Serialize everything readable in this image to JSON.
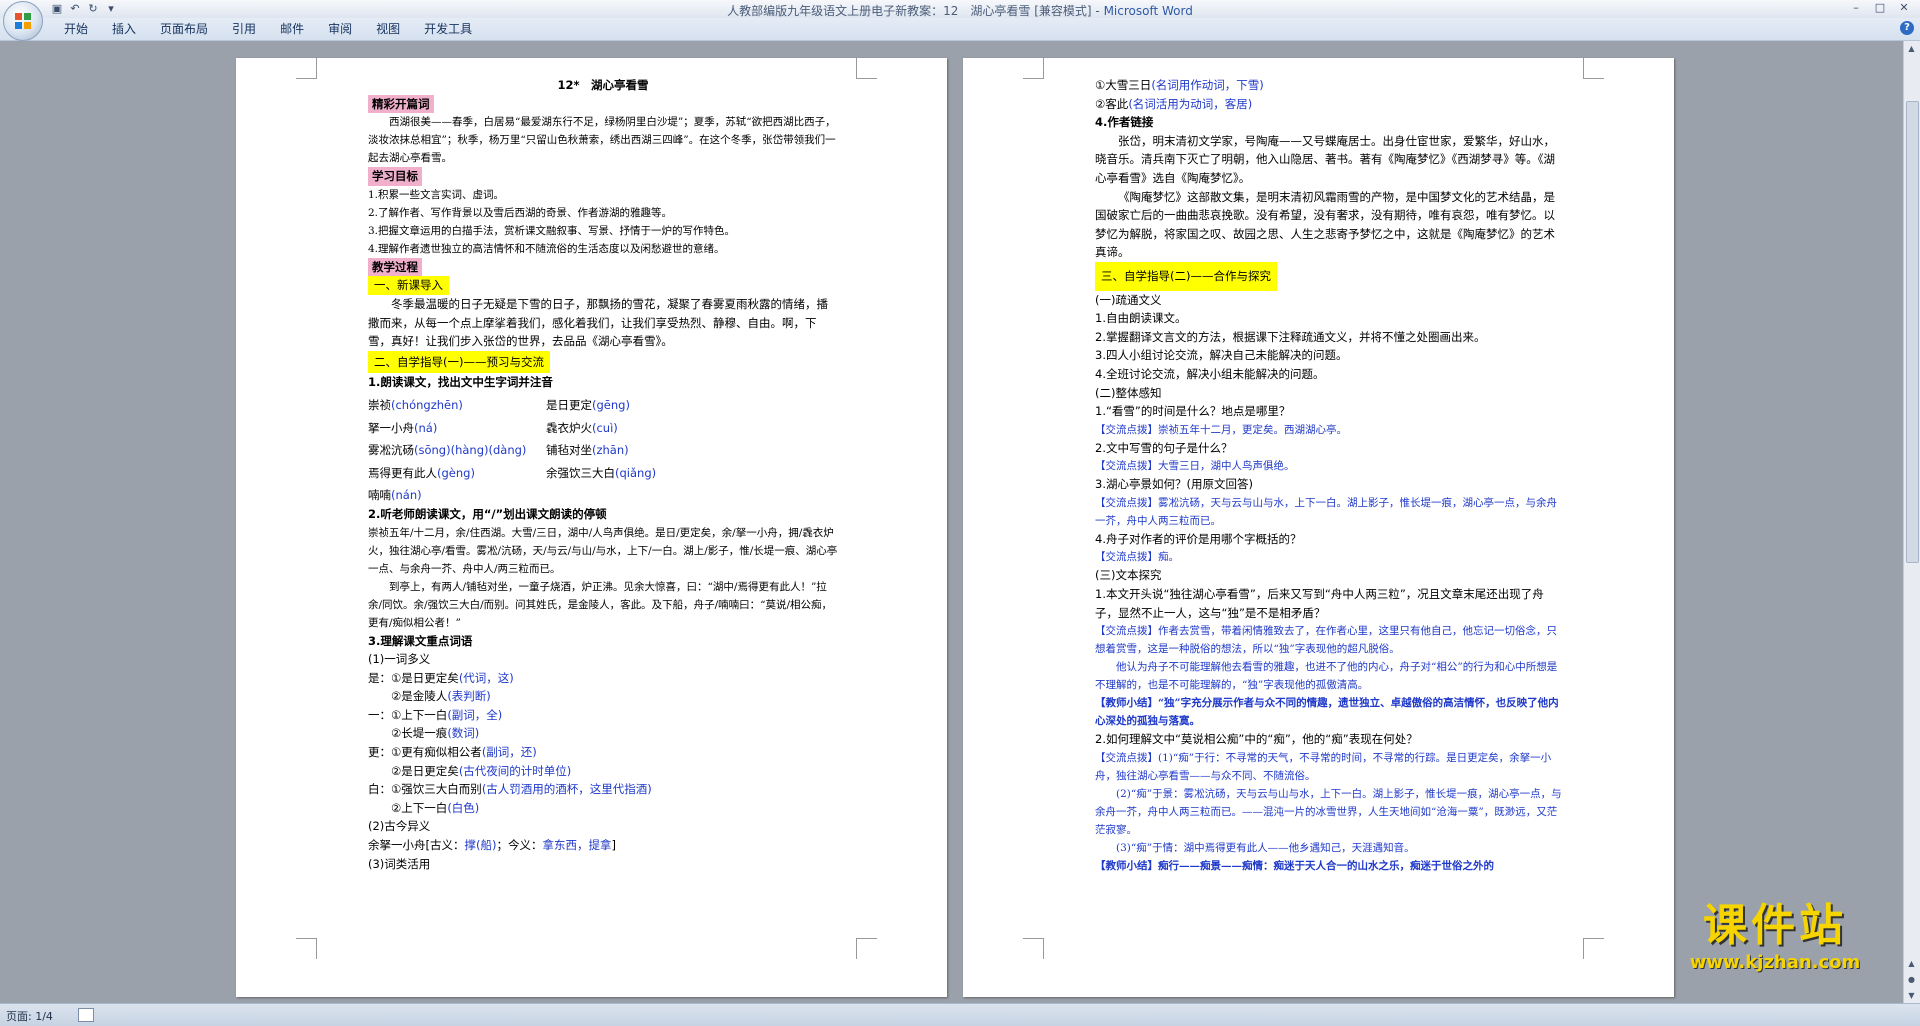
{
  "window": {
    "title": "人教部编版九年级语文上册电子新教案：12　湖心亭看雪 [兼容模式] - ",
    "app_name": "Microsoft Word",
    "help_label": "?"
  },
  "ribbon_tabs": [
    "开始",
    "插入",
    "页面布局",
    "引用",
    "邮件",
    "审阅",
    "视图",
    "开发工具"
  ],
  "status": {
    "page": "页面: 1/4"
  },
  "watermark": {
    "brand": "课件站",
    "url": "www.kjzhan.com"
  },
  "page1": {
    "title": "12*　湖心亭看雪",
    "h_intro": "精彩开篇词",
    "intro": "西湖很美——春季，白居易“最爱湖东行不足，绿杨阴里白沙堤”；夏季，苏轼“欲把西湖比西子，淡妆浓抹总相宜”；秋季，杨万里“只留山色秋萧索，绣出西湖三四峰”。在这个冬季，张岱带领我们一起去湖心亭看雪。",
    "h_goals": "学习目标",
    "goals": [
      "1.积累一些文言实词、虚词。",
      "2.了解作者、写作背景以及雪后西湖的奇景、作者游湖的雅趣等。",
      "3.把握文章运用的白描手法，赏析课文融叙事、写景、抒情于一炉的写作特色。",
      "4.理解作者遗世独立的高洁情怀和不随流俗的生活态度以及闲愁避世的意绪。"
    ],
    "h_process": "教学过程",
    "sec1_title": "一、新课导入",
    "sec1_text": "冬季最温暖的日子无疑是下雪的日子，那飘扬的雪花，凝聚了春雾夏雨秋露的情绪，播撒而来，从每一个点上摩挲着我们，感化着我们，让我们享受热烈、静穆、自由。啊，下雪，真好！让我们步入张岱的世界，去品品《湖心亭看雪》。",
    "sec2_title": "二、自学指导(一)——预习与交流",
    "read_title": "1.朗读课文，找出文中生字词并注音",
    "pinyin_rows": [
      {
        "w1": "崇祯",
        "p1": "(chóngzhēn)",
        "w2": "是日更定",
        "p2": "(gēng)"
      },
      {
        "w1": "拏一小舟",
        "p1": "(ná)",
        "w2": "毳衣炉火",
        "p2": "(cuì)"
      },
      {
        "w1": "雾凇沆砀",
        "p1": "(sōng)(hàng)(dàng)",
        "w2": "铺毡对坐",
        "p2": "(zhān)"
      },
      {
        "w1": "焉得更有此人",
        "p1": "(gèng)",
        "w2": "余强饮三大白",
        "p2": "(qiǎng)"
      },
      {
        "w1": "喃喃",
        "p1": "(nán)",
        "w2": "",
        "p2": ""
      }
    ],
    "listen_title": "2.听老师朗读课文，用“/”划出课文朗读的停顿",
    "listen_p1": "崇祯五年/十二月，余/住西湖。大雪/三日，湖中/人鸟声俱绝。是日/更定矣，余/拏一小舟，拥/毳衣炉火，独往湖心亭/看雪。雾凇/沆砀，天/与云/与山/与水，上下/一白。湖上/影子，惟/长堤一痕、湖心亭一点、与余舟一芥、舟中人/两三粒而已。",
    "listen_p2": "到亭上，有两人/铺毡对坐，一童子烧酒，炉正沸。见余大惊喜，曰：“湖中/焉得更有此人！”拉余/同饮。余/强饮三大白/而别。问其姓氏，是金陵人，客此。及下船，舟子/喃喃曰：“莫说/相公痴，更有/痴似相公者！”",
    "vocab_title": "3.理解课文重点词语",
    "vocab_sub1": "(1)一词多义",
    "vocab_lines": [
      {
        "w": "是：①是日更定矣",
        "b": "(代词，这)"
      },
      {
        "w": "　　②是金陵人",
        "b": "(表判断)"
      },
      {
        "w": "一：①上下一白",
        "b": "(副词，全)"
      },
      {
        "w": "　　②长堤一痕",
        "b": "(数词)"
      },
      {
        "w": "更：①更有痴似相公者",
        "b": "(副词，还)"
      },
      {
        "w": "　　②是日更定矣",
        "b": "(古代夜间的计时单位)"
      },
      {
        "w": "白：①强饮三大白而别",
        "b": "(古人罚酒用的酒杯，这里代指酒)"
      },
      {
        "w": "　　②上下一白",
        "b": "(白色)"
      }
    ],
    "vocab_sub2": "(2)古今异义",
    "gujin": {
      "w": "余拏一小舟[古义：",
      "b1": "撑(船)",
      "m": "；今义：",
      "b2": "拿东西，提拿",
      "e": "]"
    },
    "vocab_sub3": "(3)词类活用"
  },
  "page2": {
    "huoyong": [
      {
        "w": "①大雪三日",
        "b": "(名词用作动词，下雪)"
      },
      {
        "w": "②客此",
        "b": "(名词活用为动词，客居)"
      }
    ],
    "author_title": "4.作者链接",
    "author_p1": "张岱，明末清初文学家，号陶庵——又号蝶庵居士。出身仕宦世家，爱繁华，好山水，晓音乐。清兵南下灭亡了明朝，他入山隐居、著书。著有《陶庵梦忆》《西湖梦寻》等。《湖心亭看雪》选自《陶庵梦忆》。",
    "author_p2": "《陶庵梦忆》这部散文集，是明末清初风霜雨雪的产物，是中国梦文化的艺术结晶，是国破家亡后的一曲曲悲哀挽歌。没有希望，没有奢求，没有期待，唯有哀怨，唯有梦忆。以梦忆为解脱，将家国之叹、故园之思、人生之悲寄予梦忆之中，这就是《陶庵梦忆》的艺术真谛。",
    "sec3_title": "三、自学指导(二)——合作与探究",
    "tongdu_title": "(一)疏通文义",
    "tongdu": [
      "1.自由朗读课文。",
      "2.掌握翻译文言文的方法，根据课下注释疏通文义，并将不懂之处圈画出来。",
      "3.四人小组讨论交流，解决自己未能解决的问题。",
      "4.全班讨论交流，解决小组未能解决的问题。"
    ],
    "zhengti_title": "(二)整体感知",
    "qa": [
      {
        "q": "1.“看雪”的时间是什么？地点是哪里？",
        "tag": "【交流点拨】",
        "a": "崇祯五年十二月，更定矣。西湖湖心亭。"
      },
      {
        "q": "2.文中写雪的句子是什么？",
        "tag": "【交流点拨】",
        "a": "大雪三日，湖中人鸟声俱绝。"
      },
      {
        "q": "3.湖心亭景如何？(用原文回答)",
        "tag": "【交流点拨】",
        "a": "雾凇沆砀，天与云与山与水，上下一白。湖上影子，惟长堤一痕，湖心亭一点，与余舟一芥，舟中人两三粒而已。"
      },
      {
        "q": "4.舟子对作者的评价是用哪个字概括的？",
        "tag": "【交流点拨】",
        "a": "痴。"
      }
    ],
    "wenben_title": "(三)文本探究",
    "q5": "1.本文开头说“独往湖心亭看雪”，后来又写到“舟中人两三粒”，况且文章末尾还出现了舟子，显然不止一人，这与“独”是不是相矛盾？",
    "q5_tag": "【交流点拨】",
    "q5_a1": "作者去赏雪，带着闲情雅致去了，在作者心里，这里只有他自己，他忘记一切俗念，只想着赏雪，这是一种脱俗的想法，所以“独”字表现他的超凡脱俗。",
    "q5_a2": "他认为舟子不可能理解他去看雪的雅趣，也进不了他的内心，舟子对“相公”的行为和心中所想是不理解的，也是不可能理解的，“独”字表现他的孤傲清高。",
    "q5_tag2": "【教师小结】",
    "q5_sum": "“独”字充分展示作者与众不同的情趣，遗世独立、卓越傲俗的高洁情怀，也反映了他内心深处的孤独与落寞。",
    "q6": "2.如何理解文中“莫说相公痴”中的“痴”，他的“痴”表现在何处？",
    "q6_tag": "【交流点拨】",
    "q6_a1": "(1)“痴”于行：不寻常的天气，不寻常的时间，不寻常的行踪。是日更定矣，余拏一小舟，独往湖心亭看雪——与众不同、不随流俗。",
    "q6_a2": "(2)“痴”于景：雾凇沆砀，天与云与山与水，上下一白。湖上影子，惟长堤一痕，湖心亭一点，与余舟一芥，舟中人两三粒而已。——混沌一片的冰雪世界，人生天地间如“沧海一粟”，既渺远，又茫茫寂寥。",
    "q6_a3": "(3)“痴”于情：湖中焉得更有此人——他乡遇知己，天涯遇知音。",
    "q6_tag2": "【教师小结】",
    "q6_sum": "痴行——痴景——痴情：痴迷于天人合一的山水之乐，痴迷于世俗之外的"
  }
}
